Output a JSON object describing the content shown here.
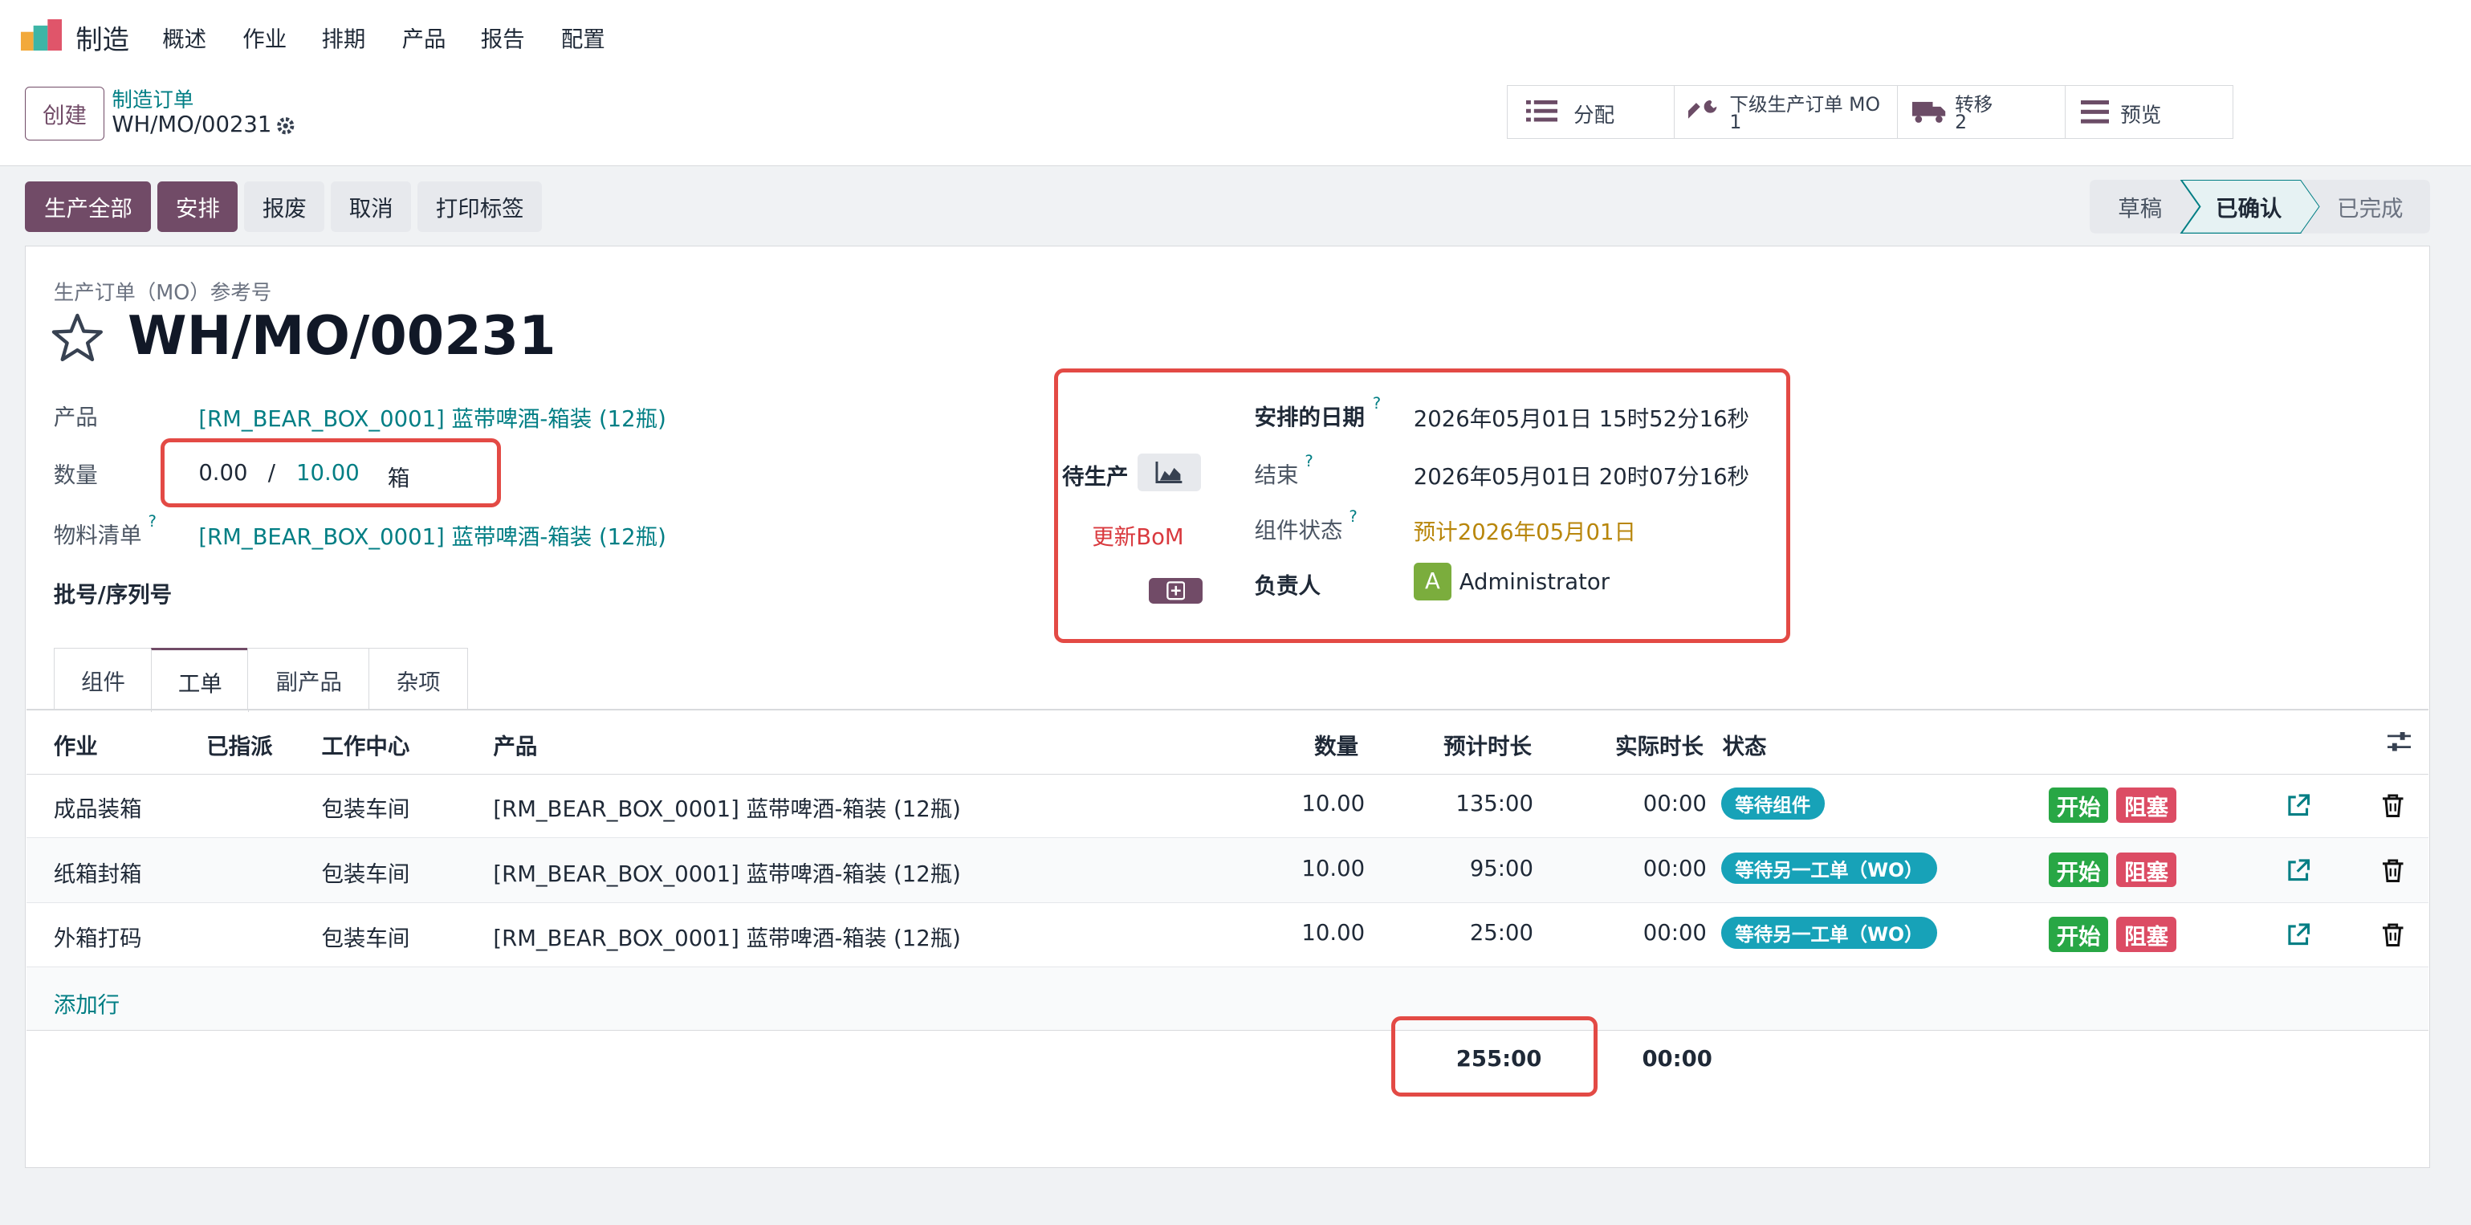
{
  "nav": {
    "app_name": "制造",
    "menu": [
      "概述",
      "作业",
      "排期",
      "产品",
      "报告",
      "配置"
    ]
  },
  "control_panel": {
    "create_label": "创建",
    "breadcrumb_parent": "制造订单",
    "record_name": "WH/MO/00231",
    "stats": {
      "allocate": "分配",
      "child_mo": "下级生产订单 MO",
      "child_mo_count": "1",
      "transfer": "转移",
      "transfer_count": "2",
      "preview": "预览"
    }
  },
  "actions": {
    "produce_all": "生产全部",
    "plan": "安排",
    "scrap": "报废",
    "cancel": "取消",
    "print_labels": "打印标签"
  },
  "statusbar": {
    "stages": [
      "草稿",
      "已确认",
      "已完成"
    ],
    "active": "已确认"
  },
  "form": {
    "ref_label": "生产订单（MO）参考号",
    "title": "WH/MO/00231",
    "product_label": "产品",
    "product_value": "[RM_BEAR_BOX_0001] 蓝带啤酒-箱装 (12瓶)",
    "qty_label": "数量",
    "qty_produced": "0.00",
    "qty_sep": "/",
    "qty_total": "10.00",
    "qty_uom": "箱",
    "bom_label": "物料清单",
    "bom_help": "?",
    "bom_value": "[RM_BEAR_BOX_0001] 蓝带啤酒-箱装 (12瓶)",
    "lot_label": "批号/序列号",
    "to_produce": "待生产",
    "update_bom": "更新BoM",
    "scheduled_label": "安排的日期",
    "scheduled_value": "2026年05月01日 15时52分16秒",
    "end_label": "结束",
    "end_value": "2026年05月01日 20时07分16秒",
    "component_status_label": "组件状态",
    "component_status_value": "预计2026年05月01日",
    "responsible_label": "负责人",
    "responsible_initial": "A",
    "responsible_value": "Administrator",
    "help_mark": "?"
  },
  "tabs": [
    "组件",
    "工单",
    "副产品",
    "杂项"
  ],
  "active_tab": "工单",
  "table": {
    "headers": {
      "operation": "作业",
      "assigned": "已指派",
      "workcenter": "工作中心",
      "product": "产品",
      "quantity": "数量",
      "expected": "预计时长",
      "real": "实际时长",
      "status": "状态"
    },
    "rows": [
      {
        "operation": "成品装箱",
        "workcenter": "包装车间",
        "product": "[RM_BEAR_BOX_0001] 蓝带啤酒-箱装 (12瓶)",
        "quantity": "10.00",
        "expected": "135:00",
        "real": "00:00",
        "status": "等待组件",
        "start": "开始",
        "block": "阻塞"
      },
      {
        "operation": "纸箱封箱",
        "workcenter": "包装车间",
        "product": "[RM_BEAR_BOX_0001] 蓝带啤酒-箱装 (12瓶)",
        "quantity": "10.00",
        "expected": "95:00",
        "real": "00:00",
        "status": "等待另一工单（WO）",
        "start": "开始",
        "block": "阻塞"
      },
      {
        "operation": "外箱打码",
        "workcenter": "包装车间",
        "product": "[RM_BEAR_BOX_0001] 蓝带啤酒-箱装 (12瓶)",
        "quantity": "10.00",
        "expected": "25:00",
        "real": "00:00",
        "status": "等待另一工单（WO）",
        "start": "开始",
        "block": "阻塞"
      }
    ],
    "add_line": "添加行",
    "total_expected": "255:00",
    "total_real": "00:00"
  },
  "colors": {
    "brand": "#714b67",
    "link": "#017e84",
    "highlight": "#e34a45",
    "badge": "#17a2b8",
    "start": "#28a745",
    "block": "#dc4c64",
    "warning": "#b8860b"
  }
}
